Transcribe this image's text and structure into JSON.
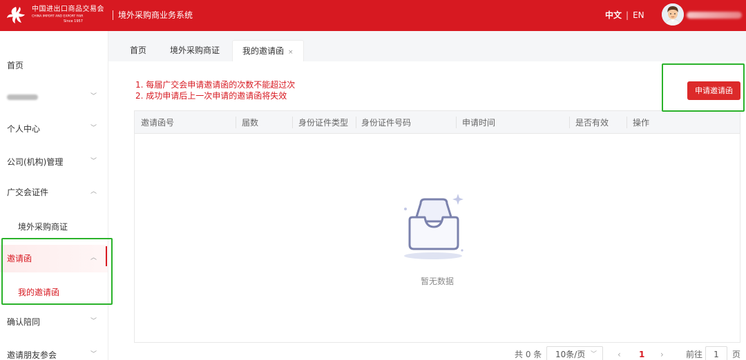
{
  "header": {
    "logo_cn": "中国进出口商品交易会",
    "logo_en": "CHINA IMPORT AND EXPORT FAIR",
    "logo_since": "Since 1957",
    "system_title": "境外采购商业务系统",
    "lang_zh": "中文",
    "lang_sep": "|",
    "lang_en": "EN"
  },
  "sidebar": {
    "items": [
      {
        "label": "首页"
      },
      {
        "label": ""
      },
      {
        "label": "个人中心"
      },
      {
        "label": "公司(机构)管理"
      },
      {
        "label": "广交会证件"
      },
      {
        "label": "境外采购商证"
      },
      {
        "label": "邀请函"
      },
      {
        "label": "我的邀请函"
      },
      {
        "label": "确认陪同"
      },
      {
        "label": "邀请朋友参会"
      }
    ]
  },
  "tabs": [
    {
      "label": "首页"
    },
    {
      "label": "境外采购商证"
    },
    {
      "label": "我的邀请函",
      "close": "×"
    }
  ],
  "notices": [
    "1. 每届广交会申请邀请函的次数不能超过次",
    "2. 成功申请后上一次申请的邀请函将失效"
  ],
  "apply_button": "申请邀请函",
  "table": {
    "columns": [
      "邀请函号",
      "届数",
      "身份证件类型",
      "身份证件号码",
      "申请时间",
      "是否有效",
      "操作"
    ],
    "rows": [],
    "empty_text": "暂无数据"
  },
  "pagination": {
    "total": "共 0 条",
    "page_size": "10条/页",
    "prev": "‹",
    "current_page": "1",
    "next": "›",
    "goto_label": "前往",
    "goto_value": "1",
    "page_suffix": "页"
  },
  "colors": {
    "brand_red": "#d71921",
    "highlight_green": "#2ab22a"
  }
}
